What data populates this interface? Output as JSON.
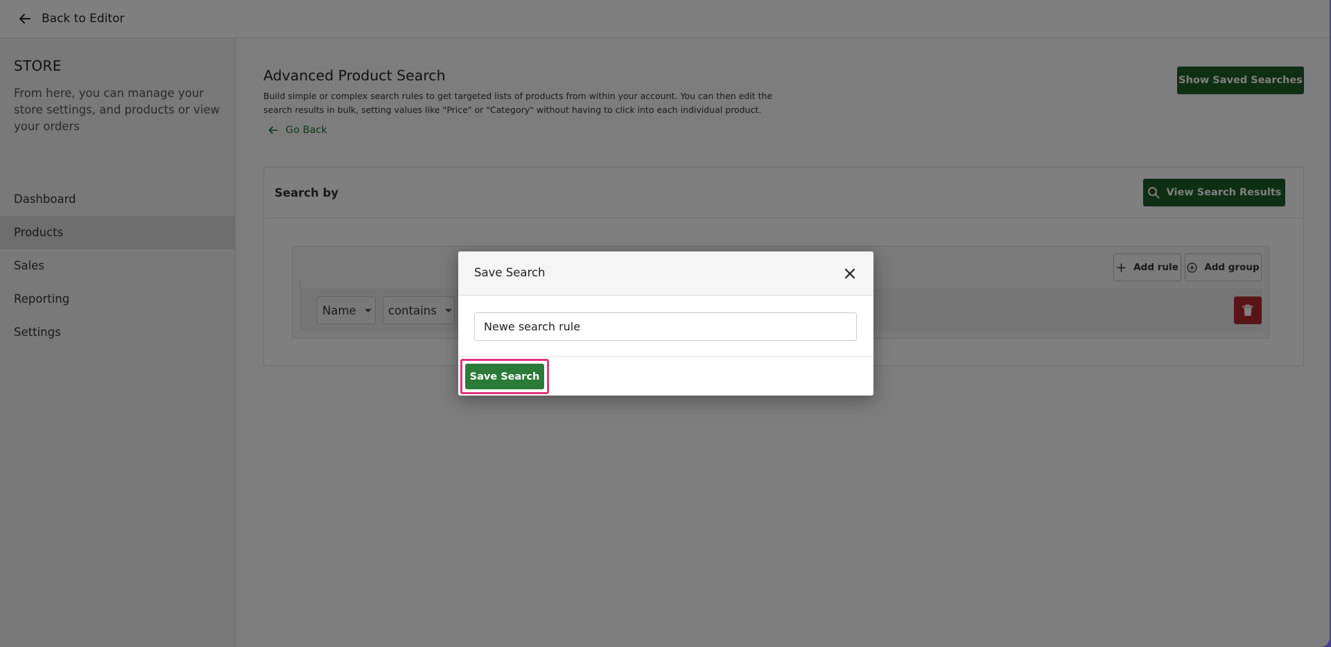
{
  "topbar": {
    "back_label": "Back to Editor"
  },
  "sidebar": {
    "title": "STORE",
    "description": "From here, you can manage your store settings, and products or view your orders",
    "items": [
      {
        "label": "Dashboard"
      },
      {
        "label": "Products"
      },
      {
        "label": "Sales"
      },
      {
        "label": "Reporting"
      },
      {
        "label": "Settings"
      }
    ],
    "active_item": "Products"
  },
  "main": {
    "title": "Advanced Product Search",
    "description": "Build simple or complex search rules to get targeted lists of products from within your account. You can then edit the search results in bulk, setting values like \"Price\" or \"Category\" without having to click into each individual product.",
    "go_back_label": "Go Back",
    "show_saved_label": "Show Saved Searches",
    "search_by_label": "Search by",
    "view_results_label": "View Search Results",
    "add_rule_label": "Add rule",
    "add_group_label": "Add group",
    "rule": {
      "field": "Name",
      "operator": "contains"
    }
  },
  "modal": {
    "title": "Save Search",
    "input_value": "Newe search rule",
    "save_label": "Save Search"
  },
  "colors": {
    "primary": "#1e5e2b",
    "danger": "#b32a2a",
    "highlight": "#e2347c",
    "frame": "#4a3f8e"
  }
}
